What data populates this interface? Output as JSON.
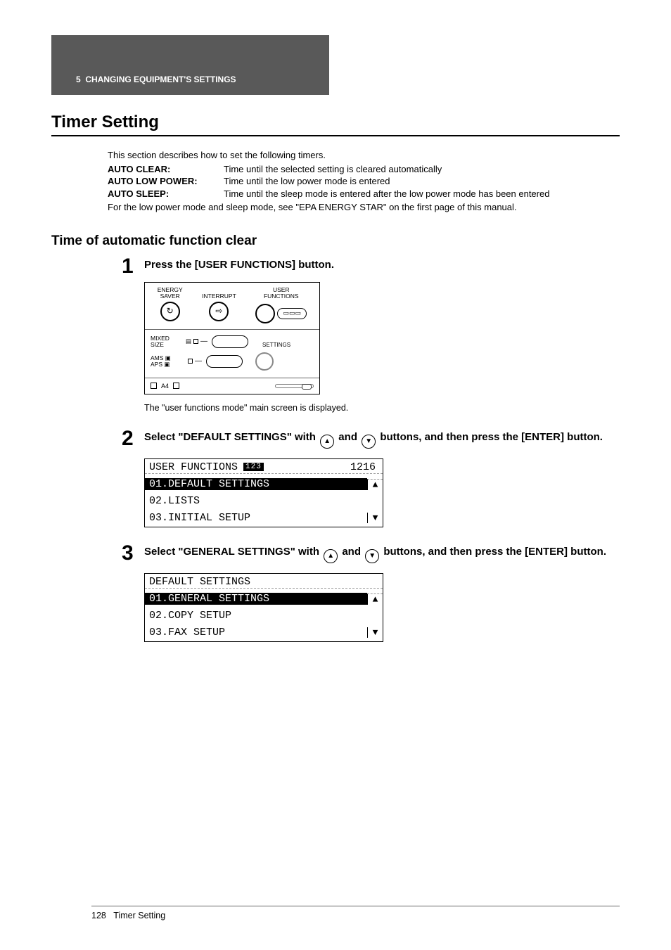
{
  "header": {
    "chapter_number": "5",
    "chapter_title": "CHANGING EQUIPMENT'S SETTINGS"
  },
  "title": "Timer Setting",
  "intro": {
    "lead": "This section describes how to set the following timers.",
    "definitions": [
      {
        "term": "AUTO CLEAR:",
        "desc": "Time until the selected setting is cleared automatically"
      },
      {
        "term": "AUTO LOW POWER:",
        "desc": "Time until the low power mode is entered"
      },
      {
        "term": "AUTO SLEEP:",
        "desc": "Time until the sleep mode is entered after the low power mode has been entered"
      }
    ],
    "footnote": "For the low power mode and sleep mode, see \"EPA ENERGY STAR\" on the first page of this manual."
  },
  "subheading": "Time of automatic function clear",
  "steps": {
    "s1": {
      "num": "1",
      "instr": "Press the [USER FUNCTIONS] button.",
      "panel": {
        "btn1_l1": "ENERGY",
        "btn1_l2": "SAVER",
        "btn2": "INTERRUPT",
        "btn3_l1": "USER",
        "btn3_l2": "FUNCTIONS",
        "pill_icon": "▭▭▭",
        "mixed": "MIXED",
        "size": "SIZE",
        "settings": "SETTINGS",
        "ams": "AMS",
        "aps": "APS",
        "a4": "A4"
      },
      "note": "The \"user functions mode\" main screen is displayed."
    },
    "s2": {
      "num": "2",
      "instr_a": "Select \"DEFAULT SETTINGS\" with ",
      "instr_b": " and ",
      "instr_c": " buttons, and then press the [ENTER] button.",
      "lcd": {
        "header": "USER FUNCTIONS",
        "tag": "123",
        "num": "1216",
        "r1": "01.DEFAULT SETTINGS",
        "r2": "02.LISTS",
        "r3": "03.INITIAL SETUP"
      }
    },
    "s3": {
      "num": "3",
      "instr_a": "Select \"GENERAL SETTINGS\" with ",
      "instr_b": " and ",
      "instr_c": " buttons, and then press the [ENTER] button.",
      "lcd": {
        "header": "DEFAULT SETTINGS",
        "r1": "01.GENERAL SETTINGS",
        "r2": "02.COPY SETUP",
        "r3": "03.FAX SETUP"
      }
    }
  },
  "footer": {
    "page": "128",
    "title": "Timer Setting"
  }
}
